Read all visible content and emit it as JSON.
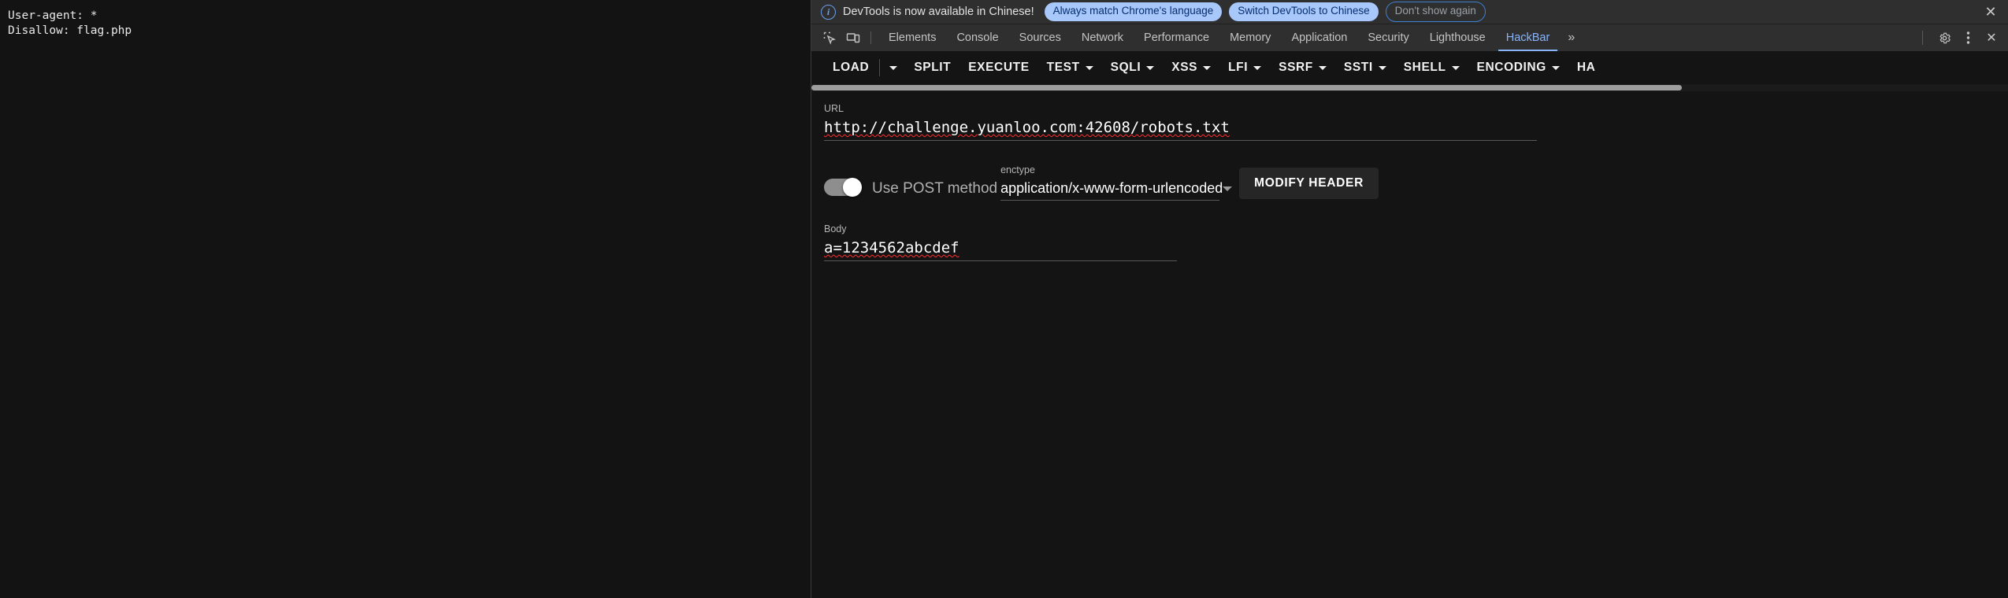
{
  "page_content": {
    "lines": [
      "User-agent: *",
      "Disallow: flag.php"
    ]
  },
  "infobar": {
    "icon": "info-circle-icon",
    "message": "DevTools is now available in Chinese!",
    "primary_button": "Always match Chrome's language",
    "secondary_button": "Switch DevTools to Chinese",
    "dismiss_button": "Don't show again",
    "close_icon": "close-icon"
  },
  "tabbar": {
    "inspect_icon": "inspect-element-icon",
    "device_icon": "device-toolbar-icon",
    "tabs": [
      {
        "label": "Elements",
        "active": false
      },
      {
        "label": "Console",
        "active": false
      },
      {
        "label": "Sources",
        "active": false
      },
      {
        "label": "Network",
        "active": false
      },
      {
        "label": "Performance",
        "active": false
      },
      {
        "label": "Memory",
        "active": false
      },
      {
        "label": "Application",
        "active": false
      },
      {
        "label": "Security",
        "active": false
      },
      {
        "label": "Lighthouse",
        "active": false
      },
      {
        "label": "HackBar",
        "active": true
      }
    ],
    "more_tabs_icon": "chevron-double-right-icon",
    "settings_icon": "gear-icon",
    "menu_icon": "more-vertical-icon",
    "close_icon": "close-icon"
  },
  "hackbar": {
    "toolbar": [
      {
        "label": "LOAD",
        "caret": false,
        "split_caret": true
      },
      {
        "label": "SPLIT",
        "caret": false,
        "split_caret": false
      },
      {
        "label": "EXECUTE",
        "caret": false,
        "split_caret": false
      },
      {
        "label": "TEST",
        "caret": true,
        "split_caret": false
      },
      {
        "label": "SQLI",
        "caret": true,
        "split_caret": false
      },
      {
        "label": "XSS",
        "caret": true,
        "split_caret": false
      },
      {
        "label": "LFI",
        "caret": true,
        "split_caret": false
      },
      {
        "label": "SSRF",
        "caret": true,
        "split_caret": false
      },
      {
        "label": "SSTI",
        "caret": true,
        "split_caret": false
      },
      {
        "label": "SHELL",
        "caret": true,
        "split_caret": false
      },
      {
        "label": "ENCODING",
        "caret": true,
        "split_caret": false
      },
      {
        "label": "HA",
        "caret": false,
        "split_caret": false
      }
    ],
    "url": {
      "label": "URL",
      "value": "http://challenge.yuanloo.com:42608/robots.txt"
    },
    "post": {
      "toggle_state": "on",
      "label": "Use POST method"
    },
    "enctype": {
      "label": "enctype",
      "value": "application/x-www-form-urlencoded",
      "caret_icon": "chevron-down-icon"
    },
    "modify_header_button": "MODIFY HEADER",
    "body": {
      "label": "Body",
      "value": "a=1234562abcdef"
    }
  },
  "colors": {
    "accent": "#8ab4f8",
    "pill_primary_bg": "#a8c7fa",
    "pill_primary_fg": "#062e6f",
    "spellcheck": "#ff2d2d",
    "panel_bg": "#141414",
    "toolbar_bg": "#2f2f2f"
  }
}
